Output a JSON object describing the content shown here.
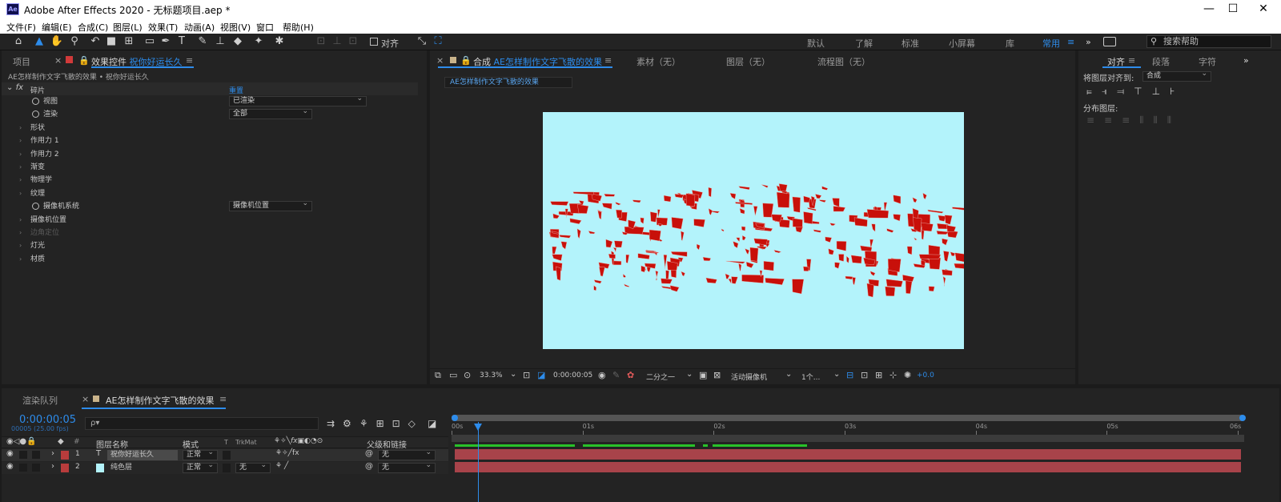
{
  "window": {
    "title": "Adobe After Effects 2020 - 无标题项目.aep *",
    "icon_text": "Ae",
    "min": "—",
    "max": "☐",
    "close": "✕"
  },
  "menu": [
    "文件(F)",
    "编辑(E)",
    "合成(C)",
    "图层(L)",
    "效果(T)",
    "动画(A)",
    "视图(V)",
    "窗口",
    "帮助(H)"
  ],
  "toolbar": {
    "align_label": "对齐",
    "workspaces": [
      "默认",
      "了解",
      "标准",
      "小屏幕",
      "库",
      "常用"
    ],
    "search_placeholder": "搜索帮助"
  },
  "left_panel": {
    "tab_project": "项目",
    "tab_effects": "效果控件",
    "effects_layer": "祝你好运长久",
    "breadcrumb": "AE怎样制作文字飞散的效果 • 祝你好运长久",
    "effect_name": "碎片",
    "reset": "重置",
    "props": [
      {
        "label": "视图",
        "value": "已渲染",
        "stopwatch": true
      },
      {
        "label": "渲染",
        "value": "全部",
        "stopwatch": true
      },
      {
        "label": "形状",
        "group": true
      },
      {
        "label": "作用力 1",
        "group": true
      },
      {
        "label": "作用力 2",
        "group": true
      },
      {
        "label": "渐变",
        "group": true
      },
      {
        "label": "物理学",
        "group": true
      },
      {
        "label": "纹理",
        "group": true
      },
      {
        "label": "摄像机系统",
        "value": "摄像机位置",
        "stopwatch": true
      },
      {
        "label": "摄像机位置",
        "group": true
      },
      {
        "label": "边角定位",
        "group": true,
        "dim": true
      },
      {
        "label": "灯光",
        "group": true
      },
      {
        "label": "材质",
        "group": true
      }
    ]
  },
  "comp_panel": {
    "tab_comp": "合成",
    "comp_name": "AE怎样制作文字飞散的效果",
    "tab_footage": "素材（无）",
    "tab_layer": "图层（无）",
    "tab_flow": "流程图（无）",
    "chip": "AE怎样制作文字飞散的效果",
    "bg_color": "#b3f3fb",
    "shard_color": "#c8100a",
    "footer": {
      "zoom": "33.3%",
      "time": "0:00:00:05",
      "resolution": "二分之一",
      "camera": "活动摄像机",
      "views": "1个...",
      "exposure": "+0.0"
    }
  },
  "right_panel": {
    "tabs": [
      "对齐",
      "段落",
      "字符"
    ],
    "align_to_label": "将图层对齐到:",
    "align_to_value": "合成",
    "distribute_label": "分布图层:"
  },
  "timeline": {
    "tab_render": "渲染队列",
    "tab_comp": "AE怎样制作文字飞散的效果",
    "timecode": "0:00:00:05",
    "fps": "00005 (25.00 fps)",
    "search_placeholder": "ρ▾",
    "headers": {
      "layer_name": "图层名称",
      "mode": "模式",
      "t": "T",
      "trkmat": "TrkMat",
      "parent": "父级和链接"
    },
    "layers": [
      {
        "num": "1",
        "type": "T",
        "name": "祝你好运长久",
        "mode": "正常",
        "trkmat": "",
        "parent": "无",
        "color": "#d13a3a",
        "label_color": "#b83c3c"
      },
      {
        "num": "2",
        "type": "□",
        "name": "纯色层",
        "mode": "正常",
        "trkmat": "无",
        "parent": "无",
        "color": "#b3f3fb",
        "label_color": "#b83c3c"
      }
    ],
    "ruler": [
      "00s",
      "01s",
      "02s",
      "03s",
      "04s",
      "05s",
      "06s"
    ],
    "playhead_fraction": 0.033
  }
}
